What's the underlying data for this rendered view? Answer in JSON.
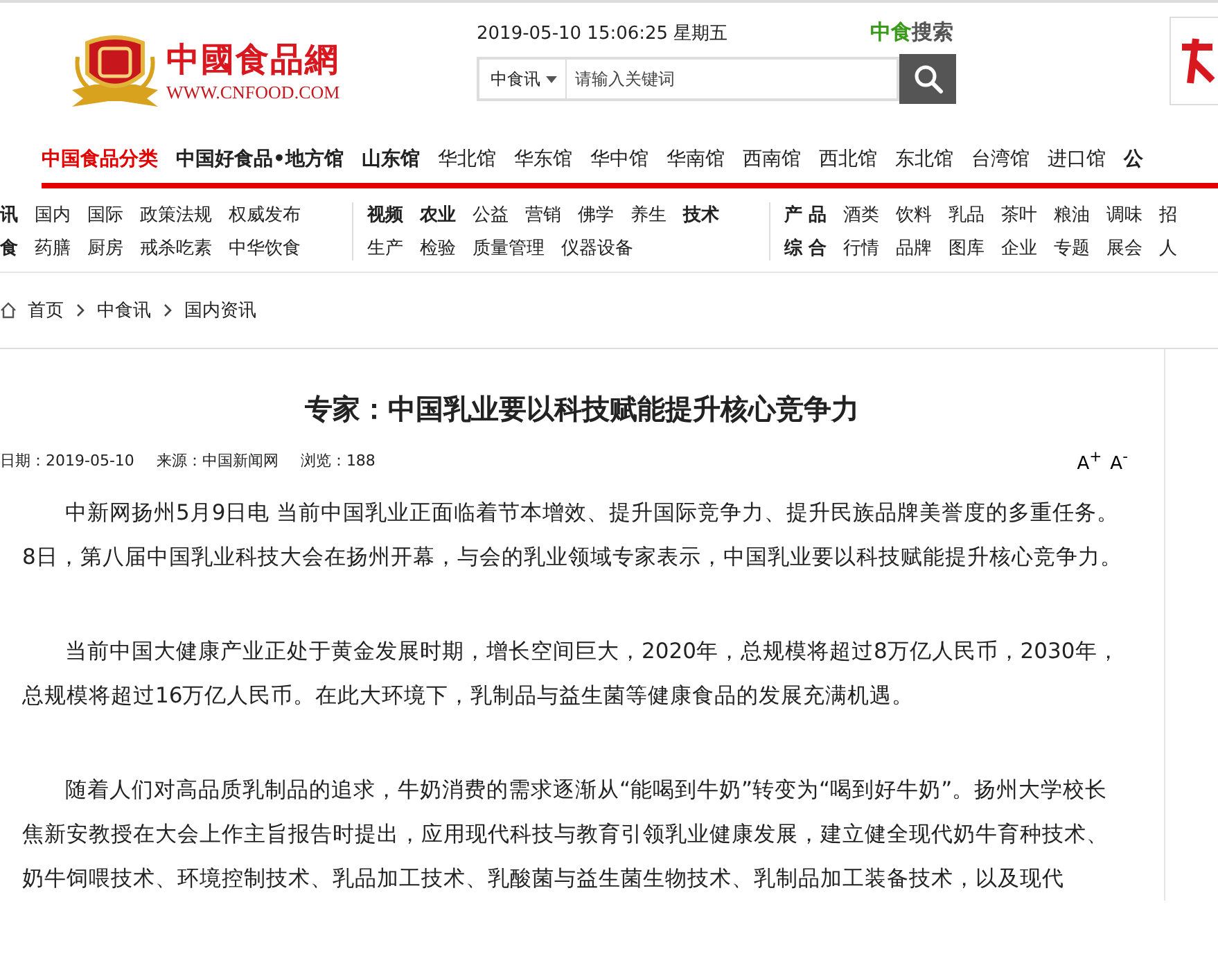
{
  "header": {
    "logo_title": "中國食品網",
    "logo_url": "WWW.CNFOOD.COM",
    "datetime": "2019-05-10 15:06:25 星期五",
    "search_brand": [
      "中食",
      "搜索"
    ],
    "search": {
      "category": "中食讯",
      "placeholder": "请输入关键词"
    }
  },
  "main_nav": [
    {
      "label": "中国食品分类",
      "selected": true,
      "bold": true
    },
    {
      "label": "中国好食品•地方馆",
      "selected": false,
      "bold": true
    },
    {
      "label": "山东馆",
      "selected": false,
      "bold": true
    },
    {
      "label": "华北馆",
      "selected": false,
      "bold": false
    },
    {
      "label": "华东馆",
      "selected": false,
      "bold": false
    },
    {
      "label": "华中馆",
      "selected": false,
      "bold": false
    },
    {
      "label": "华南馆",
      "selected": false,
      "bold": false
    },
    {
      "label": "西南馆",
      "selected": false,
      "bold": false
    },
    {
      "label": "西北馆",
      "selected": false,
      "bold": false
    },
    {
      "label": "东北馆",
      "selected": false,
      "bold": false
    },
    {
      "label": "台湾馆",
      "selected": false,
      "bold": false
    },
    {
      "label": "进口馆",
      "selected": false,
      "bold": false
    },
    {
      "label": "公",
      "selected": false,
      "bold": true
    }
  ],
  "sub_nav": [
    {
      "lines": [
        {
          "links": [
            {
              "label": "讯",
              "bold": true
            },
            {
              "label": "国内",
              "bold": false
            },
            {
              "label": "国际",
              "bold": false
            },
            {
              "label": "政策法规",
              "bold": false
            },
            {
              "label": "权威发布",
              "bold": false
            }
          ]
        },
        {
          "links": [
            {
              "label": "食",
              "bold": true
            },
            {
              "label": "药膳",
              "bold": false
            },
            {
              "label": "厨房",
              "bold": false
            },
            {
              "label": "戒杀吃素",
              "bold": false
            },
            {
              "label": "中华饮食",
              "bold": false
            }
          ]
        }
      ]
    },
    {
      "lines": [
        {
          "links": [
            {
              "label": "视频",
              "bold": true
            },
            {
              "label": "农业",
              "bold": true
            },
            {
              "label": "公益",
              "bold": false
            },
            {
              "label": "营销",
              "bold": false
            },
            {
              "label": "佛学",
              "bold": false
            },
            {
              "label": "养生",
              "bold": false
            },
            {
              "label": "技术",
              "bold": true
            }
          ]
        },
        {
          "links": [
            {
              "label": "生产",
              "bold": false
            },
            {
              "label": "检验",
              "bold": false
            },
            {
              "label": "质量管理",
              "bold": false
            },
            {
              "label": "仪器设备",
              "bold": false
            }
          ]
        }
      ]
    },
    {
      "lines": [
        {
          "links": [
            {
              "label": "产 品",
              "bold": true
            },
            {
              "label": "酒类",
              "bold": false
            },
            {
              "label": "饮料",
              "bold": false
            },
            {
              "label": "乳品",
              "bold": false
            },
            {
              "label": "茶叶",
              "bold": false
            },
            {
              "label": "粮油",
              "bold": false
            },
            {
              "label": "调味",
              "bold": false
            },
            {
              "label": "招",
              "bold": false
            }
          ]
        },
        {
          "links": [
            {
              "label": "综 合",
              "bold": true
            },
            {
              "label": "行情",
              "bold": false
            },
            {
              "label": "品牌",
              "bold": false
            },
            {
              "label": "图库",
              "bold": false
            },
            {
              "label": "企业",
              "bold": false
            },
            {
              "label": "专题",
              "bold": false
            },
            {
              "label": "展会",
              "bold": false
            },
            {
              "label": "人",
              "bold": false
            }
          ]
        }
      ]
    }
  ],
  "breadcrumb": [
    "首页",
    "中食讯",
    "国内资讯"
  ],
  "article": {
    "title": "专家：中国乳业要以科技赋能提升核心竞争力",
    "meta": [
      "日期：2019-05-10",
      "来源：中国新闻网",
      "浏览：188"
    ],
    "font_controls": [
      "A$^{+}$",
      "A$^{-}$"
    ],
    "paragraphs": [
      "中新网扬州5月9日电  当前中国乳业正面临着节本增效、提升国际竞争力、提升民族品牌美誉度的多重任务。8日，第八届中国乳业科技大会在扬州开幕，与会的乳业领域专家表示，中国乳业要以科技赋能提升核心竞争力。",
      "当前中国大健康产业正处于黄金发展时期，增长空间巨大，2020年，总规模将超过8万亿人民币，2030年，总规模将超过16万亿人民币。在此大环境下，乳制品与益生菌等健康食品的发展充满机遇。",
      "随着人们对高品质乳制品的追求，牛奶消费的需求逐渐从“能喝到牛奶”转变为“喝到好牛奶”。扬州大学校长焦新安教授在大会上作主旨报告时提出，应用现代科技与教育引领乳业健康发展，建立健全现代奶牛育种技术、奶牛饲喂技术、环境控制技术、乳品加工技术、乳酸菌与益生菌生物技术、乳制品加工装备技术，以及现代"
    ]
  }
}
